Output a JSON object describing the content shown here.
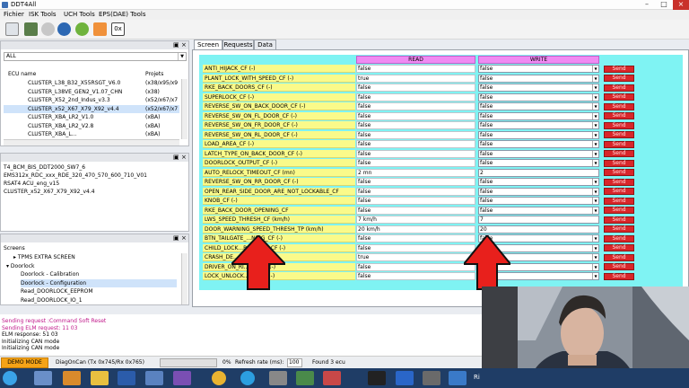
{
  "window": {
    "title": "DDT4All"
  },
  "menu": [
    "Fichier",
    "ISK Tools",
    "UCH Tools",
    "EPS(DAE) Tools"
  ],
  "toolbar": {
    "icons": [
      "scan-icon",
      "ecu-icon",
      "gear-icon",
      "refresh-icon",
      "tick-icon",
      "logo-icon",
      "hex-icon"
    ],
    "hex_label": "0x"
  },
  "ecu_panel": {
    "filter": "ALL",
    "headers": {
      "name": "ECU name",
      "projects": "Projets"
    },
    "rows": [
      {
        "name": "CLUSTER_L38_B32_X55RSGT_V6.0",
        "projects": "(x38/x95/x9"
      },
      {
        "name": "CLUSTER_L38VE_GEN2_V1.07_CHN",
        "projects": "(x38)"
      },
      {
        "name": "CLUSTER_X52_2nd_Indus_v3.3",
        "projects": "(x52/x67/x7"
      },
      {
        "name": "CLUSTER_x52_X67_X79_X92_v4.4",
        "projects": "(x52/x67/x7",
        "selected": true
      },
      {
        "name": "CLUSTER_XBA_LR2_V1.0",
        "projects": "(xBA)"
      },
      {
        "name": "CLUSTER_XBA_LR2_V2.8",
        "projects": "(xBA)"
      },
      {
        "name": "CLUSTER_XBA_L...",
        "projects": "(xBA)"
      }
    ]
  },
  "loaded_ecus": [
    "T4_BCM_BIS_DDT2000_SW7_6",
    "EMS312x_RDC_xxx_RDE_320_470_570_600_710_V01",
    "RSAT4 ACU_eng_v15",
    "CLUSTER_x52_X67_X79_X92_v4.4"
  ],
  "screens_panel": {
    "title": "Screens",
    "items": [
      {
        "label": "TPMS EXTRA SCREEN",
        "indent": 1
      },
      {
        "label": "Doorlock",
        "indent": 0,
        "expanded": true
      },
      {
        "label": "Doorlock - Calibration",
        "indent": 2
      },
      {
        "label": "Doorlock - Configuration",
        "indent": 2,
        "selected": true
      },
      {
        "label": "Read_DOORLOCK_EEPROM",
        "indent": 2
      },
      {
        "label": "Read_DOORLOCK_IO_1",
        "indent": 2
      }
    ]
  },
  "tabs": [
    "Screen",
    "Requests",
    "Data"
  ],
  "table": {
    "read_header": "READ",
    "write_header": "WRITE",
    "send_label": "Send",
    "rows": [
      {
        "name": "ANTI_HIJACK_CF (-)",
        "read": "false",
        "write": "false",
        "dropdown": true
      },
      {
        "name": "PLANT_LOCK_WITH_SPEED_CF (-)",
        "read": "true",
        "write": "false",
        "dropdown": true
      },
      {
        "name": "RKE_BACK_DOORS_CF (-)",
        "read": "false",
        "write": "false",
        "dropdown": true
      },
      {
        "name": "SUPERLOCK_CF (-)",
        "read": "false",
        "write": "false",
        "dropdown": true
      },
      {
        "name": "REVERSE_SW_ON_BACK_DOOR_CF (-)",
        "read": "false",
        "write": "false",
        "dropdown": true
      },
      {
        "name": "REVERSE_SW_ON_FL_DOOR_CF (-)",
        "read": "false",
        "write": "false",
        "dropdown": true
      },
      {
        "name": "REVERSE_SW_ON_FR_DOOR_CF (-)",
        "read": "false",
        "write": "false",
        "dropdown": true
      },
      {
        "name": "REVERSE_SW_ON_RL_DOOR_CF (-)",
        "read": "false",
        "write": "false",
        "dropdown": true
      },
      {
        "name": "LOAD_AREA_CF (-)",
        "read": "false",
        "write": "false",
        "dropdown": true
      },
      {
        "name": "LATCH_TYPE_ON_BACK_DOOR_CF (-)",
        "read": "false",
        "write": "false",
        "dropdown": true
      },
      {
        "name": "DOORLOCK_OUTPUT_CF (-)",
        "read": "false",
        "write": "false",
        "dropdown": true
      },
      {
        "name": "AUTO_RELOCK_TIMEOUT_CF (mn)",
        "read": "2 mn",
        "write": "2",
        "dropdown": false
      },
      {
        "name": "REVERSE_SW_ON_RR_DOOR_CF (-)",
        "read": "false",
        "write": "false",
        "dropdown": true
      },
      {
        "name": "OPEN_REAR_SIDE_DOOR_ARE_NOT_LOCKABLE_CF",
        "read": "false",
        "write": "false",
        "dropdown": true
      },
      {
        "name": "KNOB_CF (-)",
        "read": "false",
        "write": "false",
        "dropdown": true
      },
      {
        "name": "RKE_BACK_DOOR_OPENING_CF",
        "read": "false",
        "write": "false",
        "dropdown": true
      },
      {
        "name": "LWS_SPEED_THRESH_CF (km/h)",
        "read": "7 km/h",
        "write": "7",
        "dropdown": false
      },
      {
        "name": "DOOR_WARNING_SPEED_THRESH_TP (km/h)",
        "read": "20 km/h",
        "write": "20",
        "dropdown": false
      },
      {
        "name": "BTN_TAILGATE_...NING_CF (-)",
        "read": "false",
        "write": "false",
        "dropdown": true
      },
      {
        "name": "CHILD_LOCK...REVERSE_CF (-)",
        "read": "false",
        "write": "false",
        "dropdown": true
      },
      {
        "name": "CRASH_DE...",
        "read": "true",
        "write": "false",
        "dropdown": true
      },
      {
        "name": "DRIVER_ON_RI...IDE_CF (-)",
        "read": "false",
        "write": "false",
        "dropdown": true
      },
      {
        "name": "LOCK_UNLOCK...ON_CF (-)",
        "read": "false",
        "write": "false",
        "dropdown": true
      }
    ]
  },
  "log": [
    {
      "text": "Sending request :Command Soft Reset",
      "color": "#c0188a"
    },
    {
      "text": "Sending ELM request: 11 03",
      "color": "#c0188a"
    },
    {
      "text": "ELM response: 51 03",
      "color": "#000000"
    },
    {
      "text": "Initializing CAN mode",
      "color": "#000000"
    },
    {
      "text": "Initializing CAN mode",
      "color": "#000000"
    }
  ],
  "statusbar": {
    "demo": "DEMO MODE",
    "protocol": "DiagOnCan (Tx 0x745/Rx 0x765)",
    "progress_percent": "0%",
    "progress": 0,
    "refresh_label": "Refresh rate (ms):",
    "refresh_value": "100",
    "found": "Found 3 ecu"
  },
  "taskbar": {
    "icons": [
      "windows-icon",
      "explorer-icon",
      "media-icon",
      "folder-icon",
      "word-icon",
      "mail-icon",
      "vs-icon",
      "chrome-icon",
      "skype-icon",
      "app-icon",
      "app-icon",
      "app-icon",
      "terminal-icon",
      "bluetooth-icon",
      "app-icon",
      "app-icon"
    ],
    "partial_label": "Ri"
  },
  "colors": {
    "read_header": "#ef8af2",
    "name_cell": "#fafa8a",
    "panel_bg": "#7ff3f3",
    "send_button": "#d8262a",
    "arrow": "#e8201c",
    "demo_button": "#f5a317"
  }
}
